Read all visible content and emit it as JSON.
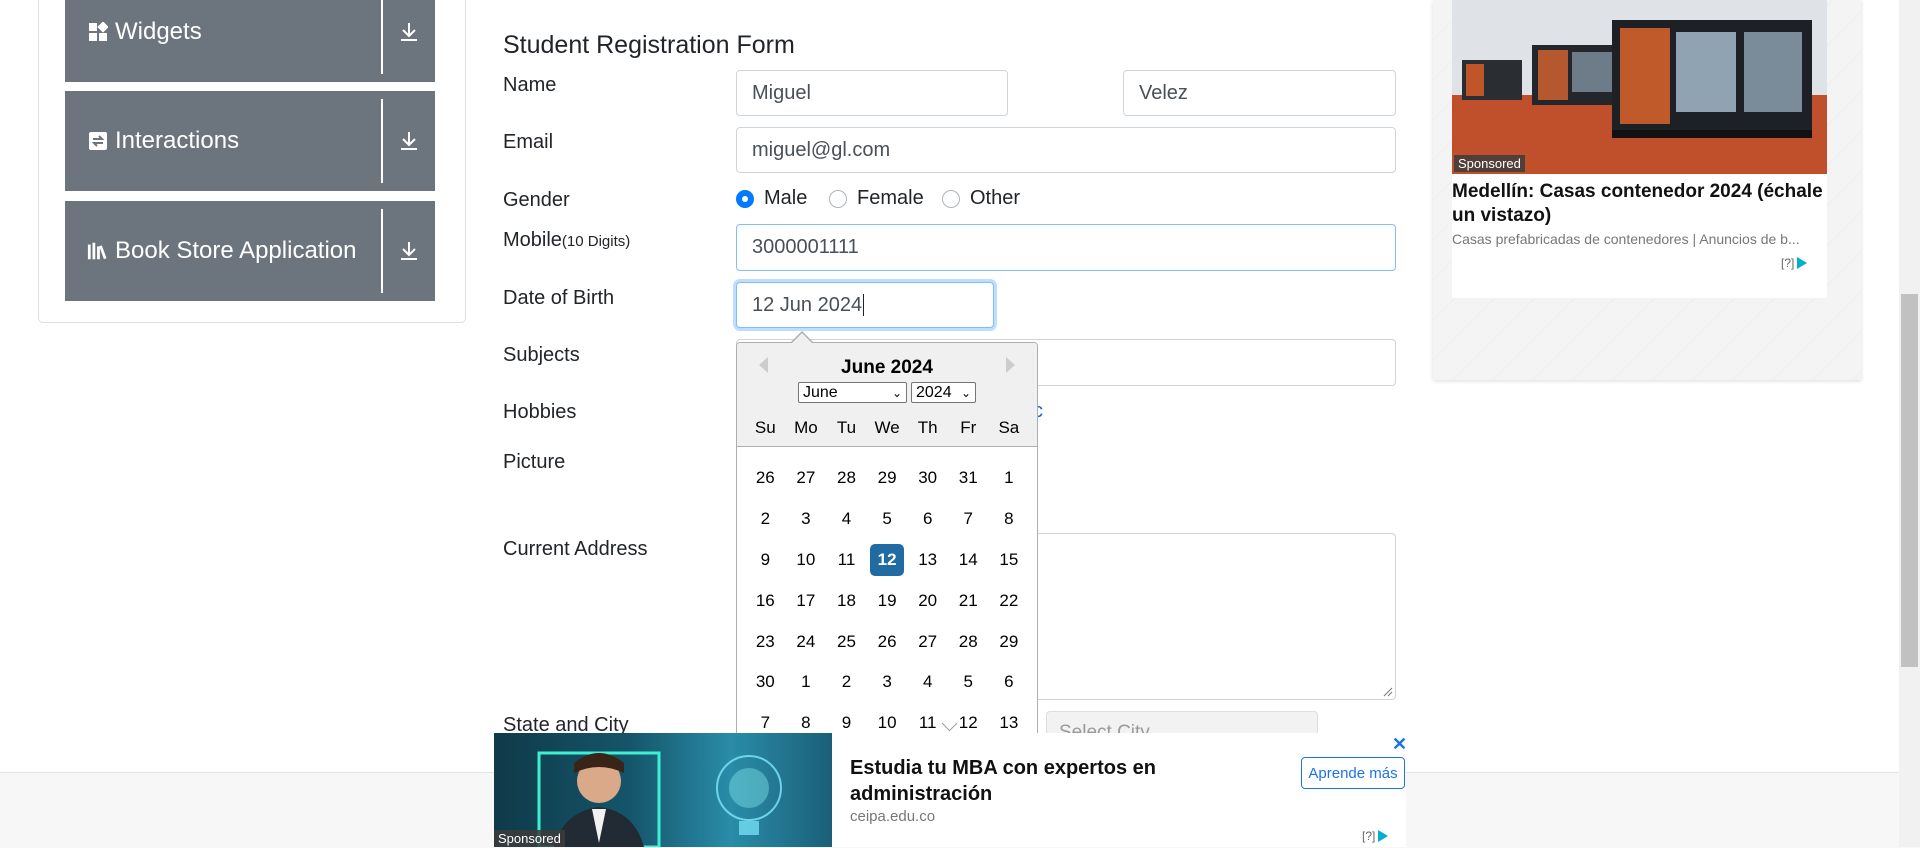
{
  "sidebar": {
    "groups": [
      {
        "label": "Widgets",
        "icon": "widgets-icon"
      },
      {
        "label": "Interactions",
        "icon": "interactions-icon"
      },
      {
        "label": "Book Store Application",
        "icon": "book-store-icon"
      }
    ]
  },
  "form": {
    "title": "Student Registration Form",
    "name_label": "Name",
    "first_name": "Miguel",
    "last_name": "Velez",
    "email_label": "Email",
    "email": "miguel@gl.com",
    "gender_label": "Gender",
    "gender_options": [
      "Male",
      "Female",
      "Other"
    ],
    "gender_selected": "Male",
    "mobile_label": "Mobile",
    "mobile_hint": "(10 Digits)",
    "mobile": "3000001111",
    "dob_label": "Date of Birth",
    "dob": "12 Jun 2024",
    "subjects_label": "Subjects",
    "hobbies_label": "Hobbies",
    "hobbies_visible_tail": "c",
    "picture_label": "Picture",
    "address_label": "Current Address",
    "state_city_label": "State and City",
    "city_placeholder": "Select City"
  },
  "datepicker": {
    "current_month": "June 2024",
    "month_select": "June",
    "year_select": "2024",
    "weekdays": [
      "Su",
      "Mo",
      "Tu",
      "We",
      "Th",
      "Fr",
      "Sa"
    ],
    "selected_day": "12",
    "weeks": [
      [
        "26",
        "27",
        "28",
        "29",
        "30",
        "31",
        "1"
      ],
      [
        "2",
        "3",
        "4",
        "5",
        "6",
        "7",
        "8"
      ],
      [
        "9",
        "10",
        "11",
        "12",
        "13",
        "14",
        "15"
      ],
      [
        "16",
        "17",
        "18",
        "19",
        "20",
        "21",
        "22"
      ],
      [
        "23",
        "24",
        "25",
        "26",
        "27",
        "28",
        "29"
      ],
      [
        "30",
        "1",
        "2",
        "3",
        "4",
        "5",
        "6"
      ],
      [
        "7",
        "8",
        "9",
        "10",
        "11",
        "12",
        "13"
      ]
    ]
  },
  "ad_right": {
    "sponsored": "Sponsored",
    "headline": "Medellín: Casas contenedor 2024 (échale un vistazo)",
    "subtext": "Casas prefabricadas de contenedores | Anuncios de b...",
    "adchoice": "[?]"
  },
  "ad_bottom": {
    "sponsored": "Sponsored",
    "title": "Estudia tu MBA con expertos en administración",
    "domain": "ceipa.edu.co",
    "cta": "Aprende más",
    "close": "✕",
    "adchoice": "[?]"
  },
  "colors": {
    "accent": "#007bff",
    "sidebar_group": "#6c757d",
    "datepicker_selected": "#216ba5"
  }
}
